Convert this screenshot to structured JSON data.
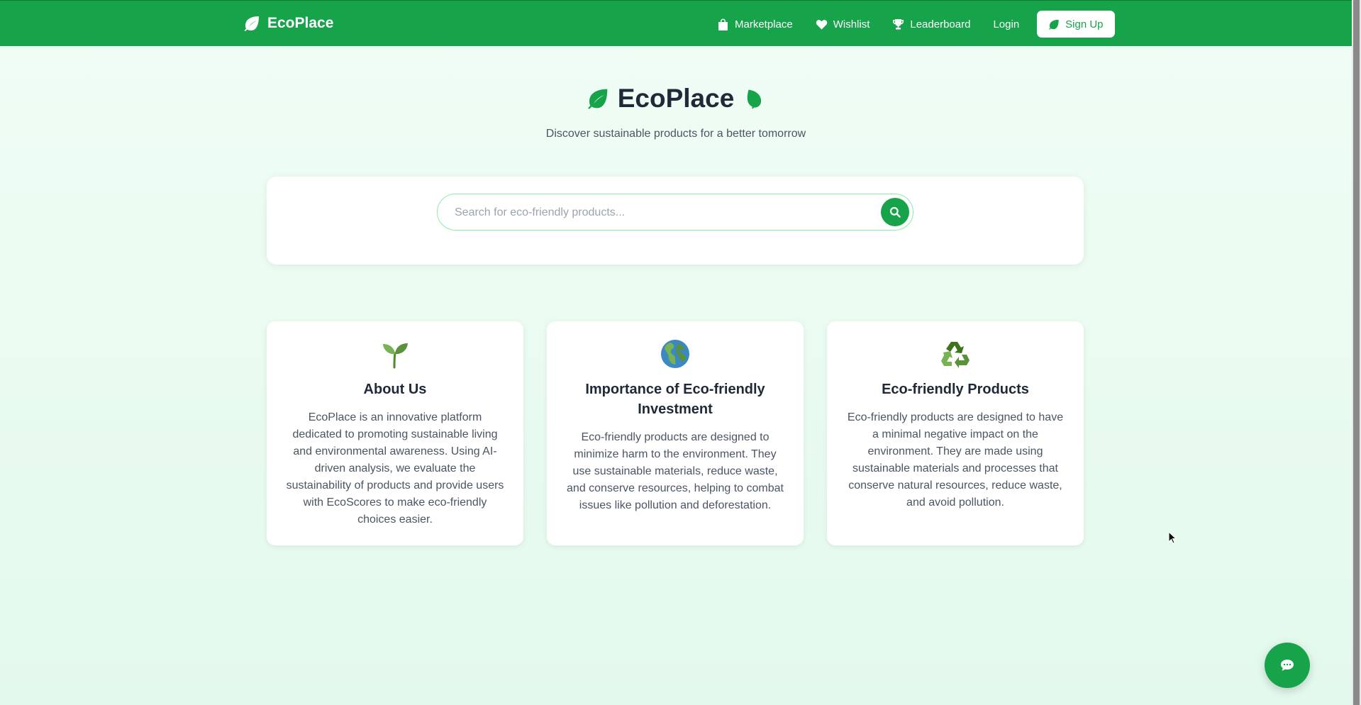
{
  "nav": {
    "brand": "EcoPlace",
    "brand_icon": "leaf-icon",
    "links": [
      {
        "label": "Marketplace",
        "icon": "shopping-bag-icon"
      },
      {
        "label": "Wishlist",
        "icon": "heart-icon"
      },
      {
        "label": "Leaderboard",
        "icon": "trophy-icon"
      },
      {
        "label": "Login"
      }
    ],
    "signup_label": "Sign Up",
    "color": "#16a34a"
  },
  "hero": {
    "title": "EcoPlace",
    "subtitle": "Discover sustainable products for a better tomorrow"
  },
  "search": {
    "placeholder": "Search for eco-friendly products...",
    "value": ""
  },
  "cards": [
    {
      "icon": "seedling-icon",
      "title": "About Us",
      "text": "EcoPlace is an innovative platform dedicated to promoting sustainable living and environmental awareness. Using AI-driven analysis, we evaluate the sustainability of products and provide users with EcoScores to make eco-friendly choices easier."
    },
    {
      "icon": "globe-icon",
      "title": "Importance of Eco-friendly Investment",
      "text": "Eco-friendly products are designed to minimize harm to the environment. They use sustainable materials, reduce waste, and conserve resources, helping to combat issues like pollution and deforestation."
    },
    {
      "icon": "recycle-icon",
      "title": "Eco-friendly Products",
      "text": "Eco-friendly products are designed to have a minimal negative impact on the environment. They are made using sustainable materials and processes that conserve natural resources, reduce waste, and avoid pollution."
    }
  ],
  "chat": {
    "icon": "chat-bubble-icon"
  }
}
